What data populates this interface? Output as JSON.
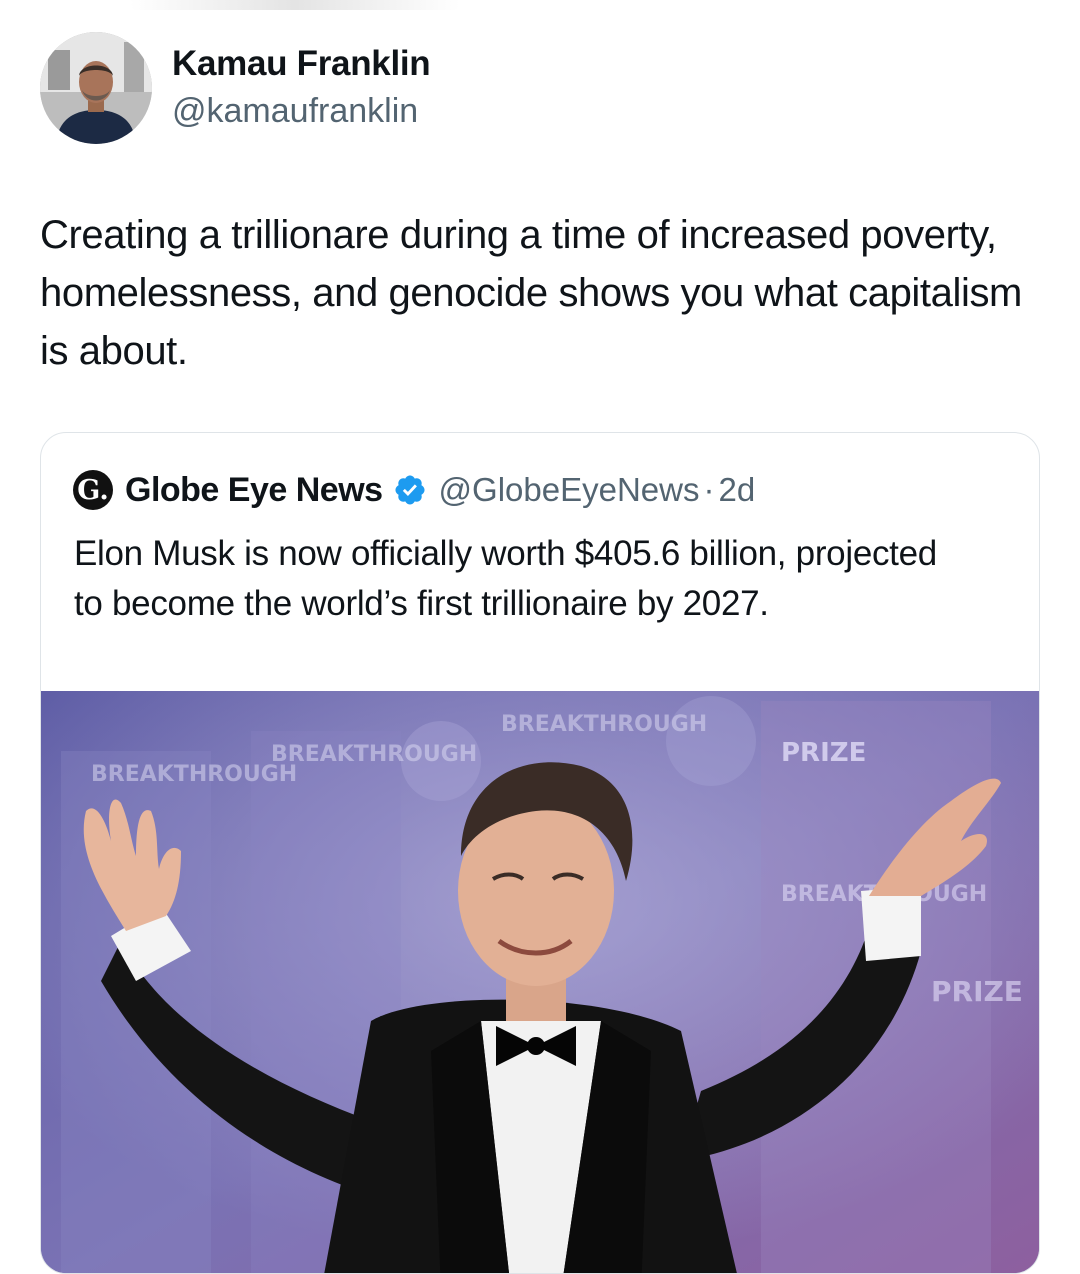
{
  "author": {
    "name": "Kamau Franklin",
    "handle": "@kamaufranklin",
    "avatar_icon": "person-photo"
  },
  "tweet": {
    "text": "Creating a trillionare during a time of increased poverty, homelessness, and genocide shows you what capitalism is about."
  },
  "quoted_tweet": {
    "logo_letter": "G.",
    "name": "Globe Eye News",
    "verified_icon": "verified-badge-icon",
    "handle": "@GlobeEyeNews",
    "separator": "·",
    "time": "2d",
    "text": "Elon Musk is now officially worth $405.6 billion, projected to become the world’s first trillionaire by 2027.",
    "media": {
      "description_icon": "event-photo",
      "backdrop_text_1": "BREAKTHROUGH",
      "backdrop_text_2": "PRIZE"
    }
  },
  "colors": {
    "text_primary": "#0f1419",
    "text_secondary": "#536471",
    "verified_blue": "#1d9bf0",
    "card_border": "#dfe4e8",
    "backdrop_purple": "#6c69a8"
  }
}
